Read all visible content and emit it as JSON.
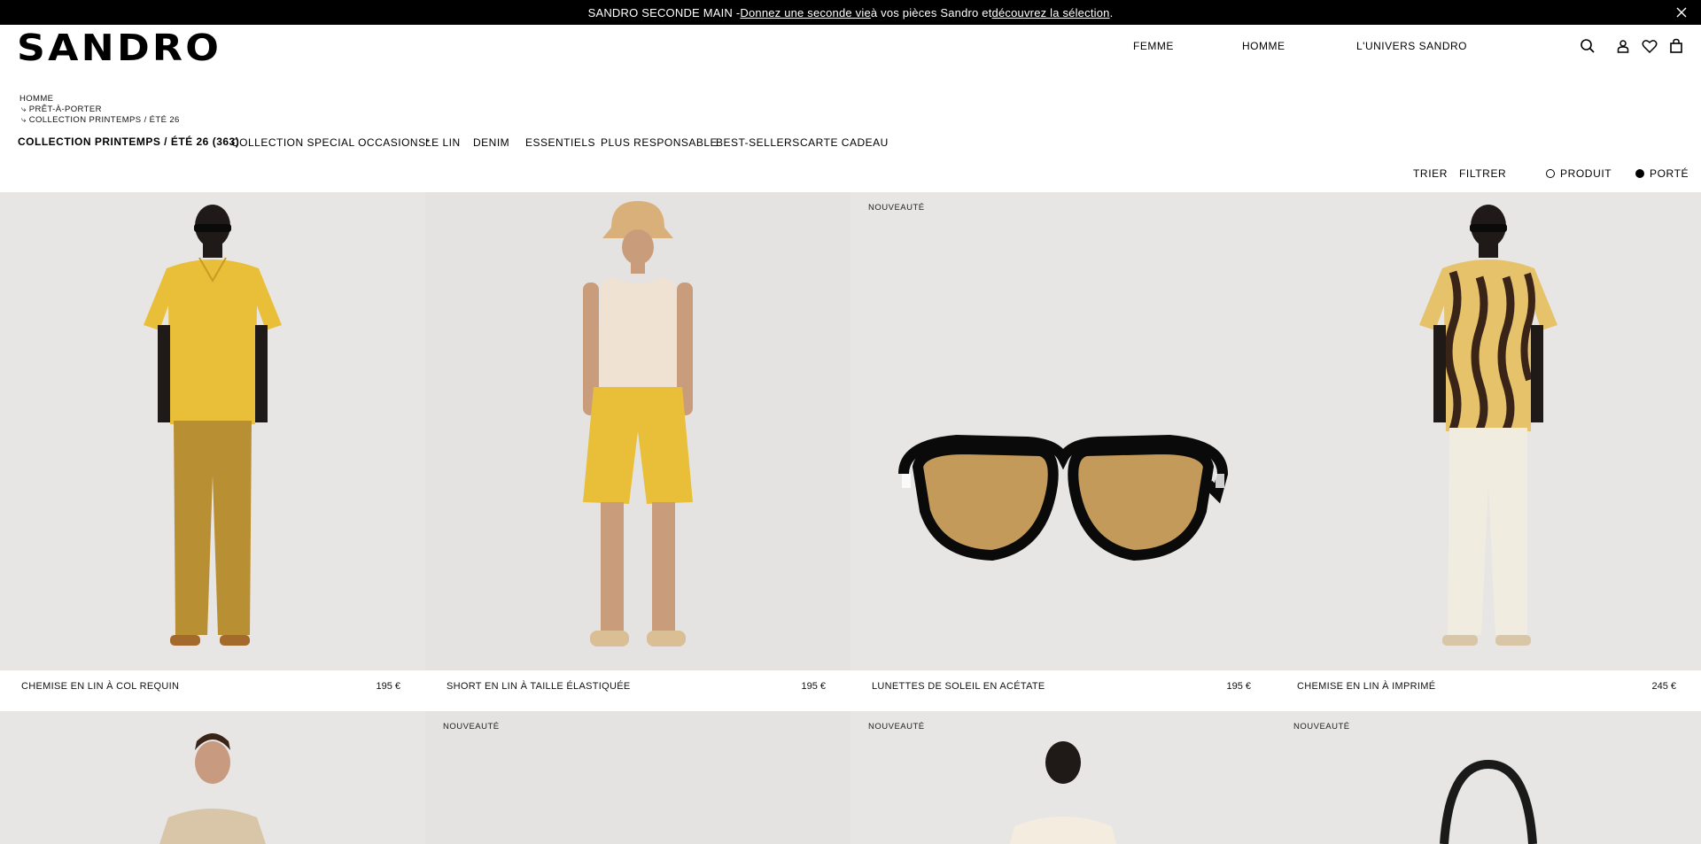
{
  "announcement": {
    "prefix": "SANDRO SECONDE MAIN - ",
    "link1": "Donnez une seconde vie",
    "middle": " à vos pièces Sandro et ",
    "link2": "découvrez la sélection",
    "suffix": "."
  },
  "header": {
    "logo": "SANDRO",
    "nav": [
      "FEMME",
      "HOMME",
      "L'UNIVERS SANDRO"
    ],
    "icons": [
      "search-icon",
      "account-icon",
      "wishlist-icon",
      "bag-icon"
    ]
  },
  "breadcrumb": [
    "HOMME",
    "⤷ PRÊT-À-PORTER",
    "⤷ COLLECTION PRINTEMPS / ÉTÉ 26"
  ],
  "categories": [
    "COLLECTION PRINTEMPS / ÉTÉ 26 (363)",
    "COLLECTION SPECIAL OCCASIONS*",
    "LE LIN",
    "DENIM",
    "ESSENTIELS",
    "PLUS RESPONSABLE",
    "BEST-SELLERS",
    "CARTE CADEAU"
  ],
  "controls": {
    "sort": "TRIER",
    "filter": "FILTRER",
    "view_product": "PRODUIT",
    "view_worn": "PORTÉ",
    "selected_view": "PORTÉ"
  },
  "products": [
    {
      "name": "CHEMISE EN LIN À COL REQUIN",
      "price": "195 €",
      "badge": ""
    },
    {
      "name": "SHORT EN LIN À TAILLE ÉLASTIQUÉE",
      "price": "195 €",
      "badge": ""
    },
    {
      "name": "LUNETTES DE SOLEIL EN ACÉTATE",
      "price": "195 €",
      "badge": "NOUVEAUTÉ"
    },
    {
      "name": "CHEMISE EN LIN À IMPRIMÉ",
      "price": "245 €",
      "badge": ""
    }
  ],
  "products_row2": [
    {
      "badge": ""
    },
    {
      "badge": "NOUVEAUTÉ"
    },
    {
      "badge": "NOUVEAUTÉ"
    },
    {
      "badge": "NOUVEAUTÉ"
    }
  ],
  "colors": {
    "announce_bg": "#000000",
    "photo_bg": "#e7e6e4",
    "yellow": "#e9bf3a",
    "ochre": "#b98f33"
  }
}
